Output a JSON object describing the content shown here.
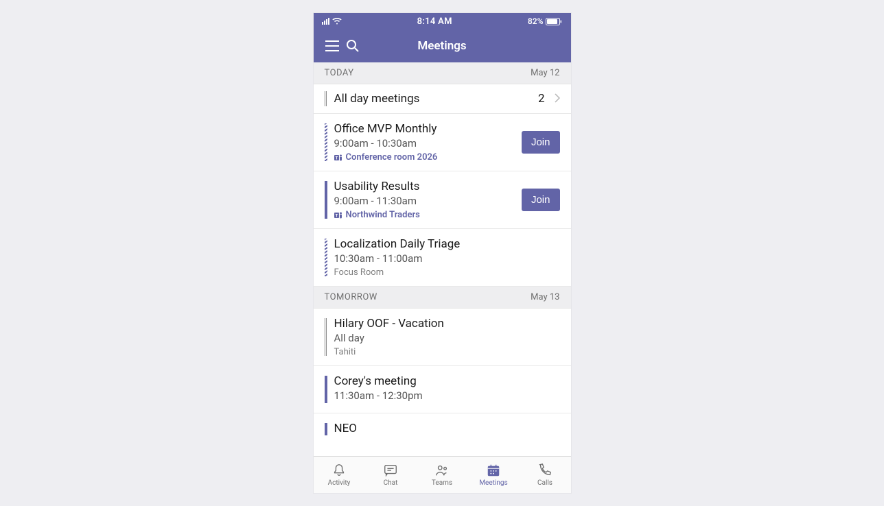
{
  "status_bar": {
    "time": "8:14 AM",
    "battery": "82%"
  },
  "header": {
    "title": "Meetings"
  },
  "allday": {
    "title": "All day meetings",
    "count": "2"
  },
  "sections": [
    {
      "label": "TODAY",
      "date": "May 12",
      "events": [
        {
          "title": "Office MVP Monthly",
          "time": "9:00am - 10:30am",
          "location": "Conference room 2026",
          "teams": true,
          "join": true,
          "marker": "striped"
        },
        {
          "title": "Usability Results",
          "time": "9:00am - 11:30am",
          "location": "Northwind Traders",
          "teams": true,
          "join": true,
          "marker": "solid"
        },
        {
          "title": "Localization Daily Triage",
          "time": "10:30am - 11:00am",
          "location": "Focus Room",
          "teams": false,
          "join": false,
          "marker": "striped"
        }
      ]
    },
    {
      "label": "TOMORROW",
      "date": "May 13",
      "events": [
        {
          "title": "Hilary OOF - Vacation",
          "time": "All day",
          "location": "Tahiti",
          "teams": false,
          "join": false,
          "marker": "gray"
        },
        {
          "title": "Corey's meeting",
          "time": "11:30am - 12:30pm",
          "location": "",
          "teams": false,
          "join": false,
          "marker": "solid"
        },
        {
          "title": "NEO",
          "time": "",
          "location": "",
          "teams": false,
          "join": false,
          "marker": "solid"
        }
      ]
    }
  ],
  "join_label": "Join",
  "tabs": [
    {
      "label": "Activity",
      "active": false
    },
    {
      "label": "Chat",
      "active": false
    },
    {
      "label": "Teams",
      "active": false
    },
    {
      "label": "Meetings",
      "active": true
    },
    {
      "label": "Calls",
      "active": false
    }
  ]
}
